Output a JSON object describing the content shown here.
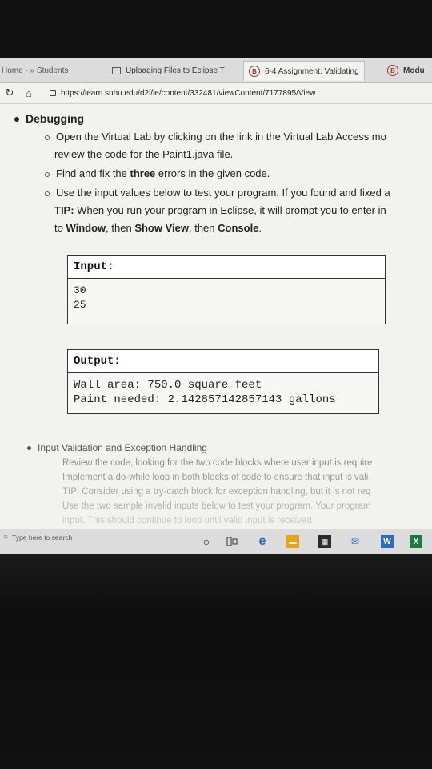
{
  "browser": {
    "tabs": [
      {
        "label": "Home - » Students"
      },
      {
        "label": "Uploading Files to Eclipse T"
      },
      {
        "label": "6-4 Assignment: Validating"
      },
      {
        "label": "Modu"
      }
    ],
    "url": "https://learn.snhu.edu/d2l/le/content/332481/viewContent/7177895/View"
  },
  "debugging": {
    "heading": "Debugging",
    "items": [
      {
        "line1": "Open the Virtual Lab by clicking on the link in the Virtual Lab Access mo",
        "line2": "review the code for the Paint1.java file."
      },
      {
        "line1_a": "Find and fix the ",
        "line1_b": "three",
        "line1_c": " errors in the given code."
      },
      {
        "line1": "Use the input values below to test your program. If you found and fixed a",
        "line2_a": "TIP:",
        "line2_b": " When you run your program in Eclipse, it will prompt you to enter in",
        "line3_a": "to ",
        "line3_b": "Window",
        "line3_c": ", then ",
        "line3_d": "Show View",
        "line3_e": ", then ",
        "line3_f": "Console",
        "line3_g": "."
      }
    ]
  },
  "input_box": {
    "header": "Input:",
    "values": [
      "30",
      "25"
    ]
  },
  "output_box": {
    "header": "Output:",
    "lines": [
      "Wall area: 750.0 square feet",
      "Paint needed: 2.142857142857143 gallons"
    ]
  },
  "validation": {
    "heading": "Input Validation and Exception Handling",
    "items": [
      "Review the code, looking for the two code blocks where user input is require",
      "Implement a do-while loop in both blocks of code to ensure that input is vali",
      "TIP: Consider using a try-catch block for exception handling, but it is not req",
      "Use the two sample invalid inputs below to test your program. Your program",
      "input. This should continue to loop until valid input is received"
    ]
  },
  "taskbar": {
    "search_placeholder": "Type here to search"
  }
}
